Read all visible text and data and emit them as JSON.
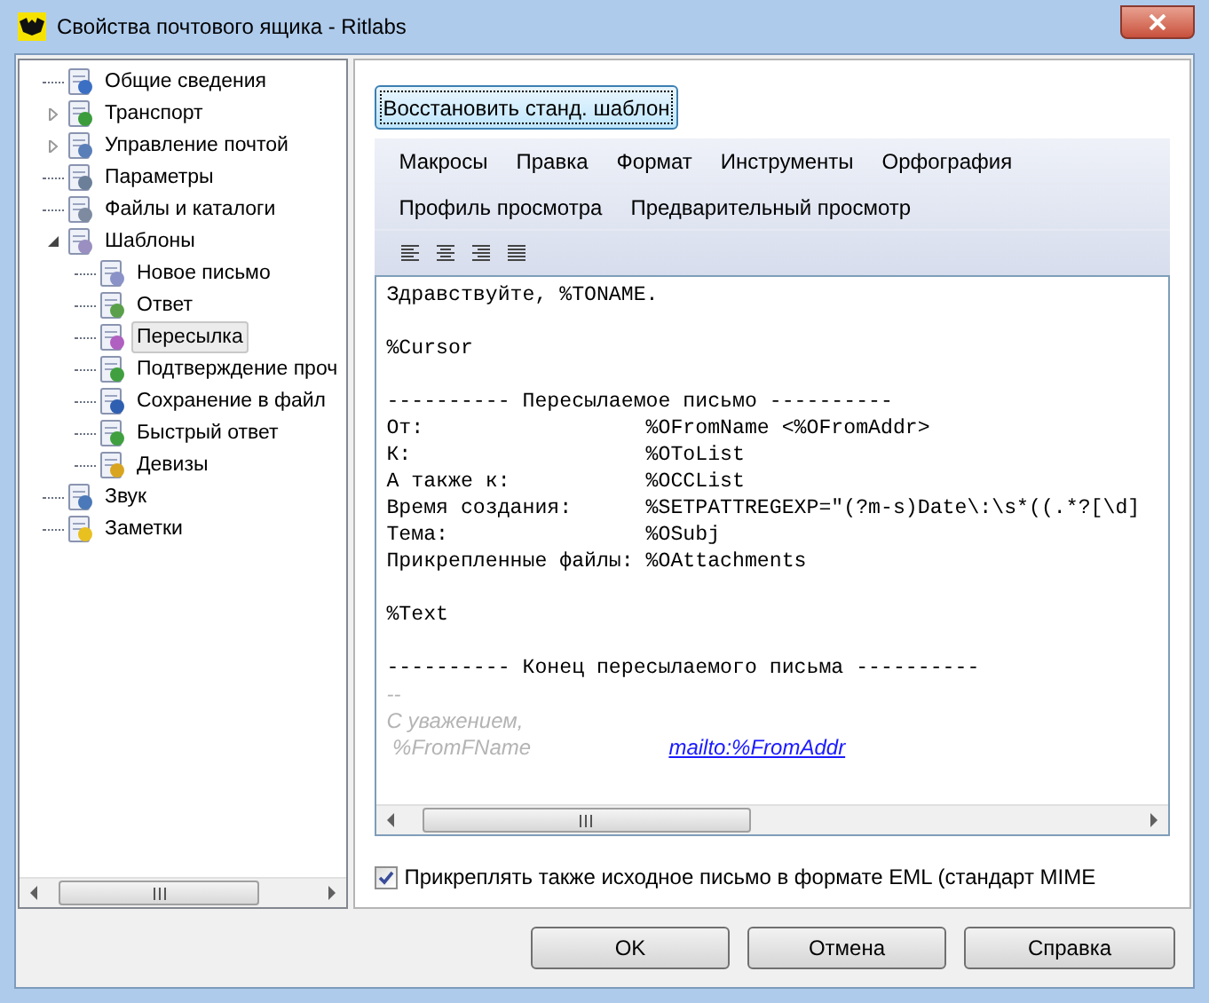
{
  "window": {
    "title": "Свойства почтового ящика - Ritlabs"
  },
  "tree": [
    {
      "label": "Общие сведения",
      "selected": false
    },
    {
      "label": "Транспорт",
      "selected": false,
      "expanded": false
    },
    {
      "label": "Управление почтой",
      "selected": false,
      "expanded": false
    },
    {
      "label": "Параметры",
      "selected": false
    },
    {
      "label": "Файлы и каталоги",
      "selected": false
    },
    {
      "label": "Шаблоны",
      "selected": false,
      "expanded": true,
      "children": [
        {
          "label": "Новое письмо",
          "selected": false
        },
        {
          "label": "Ответ",
          "selected": false
        },
        {
          "label": "Пересылка",
          "selected": true
        },
        {
          "label": "Подтверждение проч",
          "selected": false
        },
        {
          "label": "Сохранение в файл",
          "selected": false
        },
        {
          "label": "Быстрый ответ",
          "selected": false
        },
        {
          "label": "Девизы",
          "selected": false
        }
      ]
    },
    {
      "label": "Звук",
      "selected": false
    },
    {
      "label": "Заметки",
      "selected": false
    }
  ],
  "restore_button": "Восстановить станд. шаблон",
  "menu_rows": [
    [
      "Макросы",
      "Правка",
      "Формат",
      "Инструменты",
      "Орфография"
    ],
    [
      "Профиль просмотра",
      "Предварительный просмотр"
    ]
  ],
  "editor_lines": [
    {
      "kind": "mono",
      "text": "Здравствуйте, %TONAME."
    },
    {
      "kind": "blank"
    },
    {
      "kind": "mono",
      "text": "%Cursor"
    },
    {
      "kind": "blank"
    },
    {
      "kind": "mono",
      "text": "---------- Пересылаемое письмо ----------"
    },
    {
      "kind": "mono",
      "text": "От:                  %OFromName <%OFromAddr>"
    },
    {
      "kind": "mono",
      "text": "К:                   %OToList"
    },
    {
      "kind": "mono",
      "text": "А также к:           %OCCList"
    },
    {
      "kind": "mono",
      "text": "Время создания:      %SETPATTREGEXP=\"(?m-s)Date\\:\\s*((.*?[\\d]"
    },
    {
      "kind": "mono",
      "text": "Тема:                %OSubj"
    },
    {
      "kind": "mono",
      "text": "Прикрепленные файлы: %OAttachments"
    },
    {
      "kind": "blank"
    },
    {
      "kind": "mono",
      "text": "%Text"
    },
    {
      "kind": "blank"
    },
    {
      "kind": "mono",
      "text": "---------- Конец пересылаемого письма ----------"
    },
    {
      "kind": "signature",
      "text": "--"
    },
    {
      "kind": "signature",
      "text": "С уважением,"
    },
    {
      "kind": "signature",
      "text": " %FromFName",
      "link": "mailto:%FromAddr"
    }
  ],
  "attach_checkbox": {
    "label": "Прикреплять также исходное письмо в формате EML (стандарт MIME",
    "checked": true
  },
  "buttons": [
    "OK",
    "Отмена",
    "Справка"
  ]
}
